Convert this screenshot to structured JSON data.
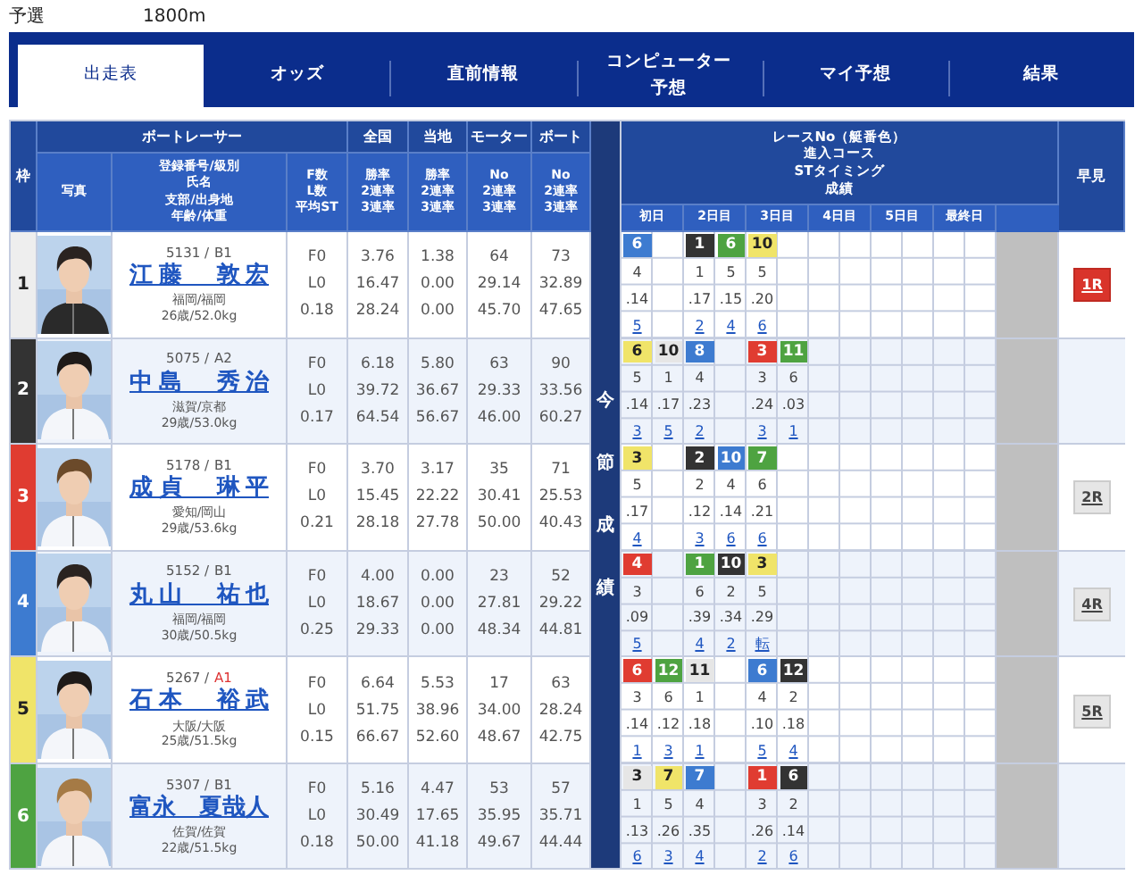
{
  "race": {
    "category": "予選",
    "distance": "1800m"
  },
  "tabs": [
    {
      "label": "出走表",
      "selected": true
    },
    {
      "label": "オッズ",
      "selected": false
    },
    {
      "label": "直前情報",
      "selected": false
    },
    {
      "label": "コンピューター予想",
      "selected": false
    },
    {
      "label": "マイ予想",
      "selected": false
    },
    {
      "label": "結果",
      "selected": false
    }
  ],
  "header": {
    "frame": "枠",
    "racer_group": "ボートレーサー",
    "photo": "写真",
    "profile_lines": [
      "登録番号/級別",
      "氏名",
      "支部/出身地",
      "年齢/体重"
    ],
    "fl_lines": [
      "F数",
      "L数",
      "平均ST"
    ],
    "stat_groups": [
      {
        "title": "全国",
        "lines": [
          "勝率",
          "2連率",
          "3連率"
        ]
      },
      {
        "title": "当地",
        "lines": [
          "勝率",
          "2連率",
          "3連率"
        ]
      },
      {
        "title": "モーター",
        "lines": [
          "No",
          "2連率",
          "3連率"
        ]
      },
      {
        "title": "ボート",
        "lines": [
          "No",
          "2連率",
          "3連率"
        ]
      }
    ],
    "series_title_lines": [
      "レースNo（艇番色）",
      "進入コース",
      "STタイミング",
      "成績"
    ],
    "days": [
      "初日",
      "2日目",
      "3日目",
      "4日目",
      "5日目",
      "最終日"
    ],
    "early_look": "早見",
    "series_side": "今節成績"
  },
  "racers": [
    {
      "frame": "1",
      "color": "#eeeeee",
      "reg": "5131 /",
      "class": "B1",
      "class_emphasis": false,
      "name": "江藤　敦宏",
      "branch": "福岡/福岡",
      "age_weight": "26歳/52.0kg",
      "fl": [
        "F0",
        "L0",
        "0.18"
      ],
      "stats": [
        [
          "3.76",
          "16.47",
          "28.24"
        ],
        [
          "1.38",
          "0.00",
          "0.00"
        ],
        [
          "64",
          "29.14",
          "45.70"
        ],
        [
          "73",
          "32.89",
          "47.65"
        ]
      ],
      "days": [
        {
          "races": [
            {
              "race_no": "6",
              "color": "#3d7bd0",
              "course": "4",
              "st": ".14",
              "result": "5"
            }
          ]
        },
        {
          "races": [
            {
              "race_no": "1",
              "color": "#333333",
              "course": "1",
              "st": ".17",
              "result": "2"
            },
            {
              "race_no": "6",
              "color": "#4ea341",
              "course": "5",
              "st": ".15",
              "result": "4"
            }
          ]
        },
        {
          "races": [
            {
              "race_no": "10",
              "color": "#f0e469",
              "course": "5",
              "st": ".20",
              "result": "6"
            }
          ]
        }
      ],
      "early_look": {
        "label": "1R",
        "highlighted": true
      }
    },
    {
      "frame": "2",
      "color": "#333333",
      "reg": "5075 /",
      "class": "A2",
      "class_emphasis": false,
      "name": "中島　秀治",
      "branch": "滋賀/京都",
      "age_weight": "29歳/53.0kg",
      "fl": [
        "F0",
        "L0",
        "0.17"
      ],
      "stats": [
        [
          "6.18",
          "39.72",
          "64.54"
        ],
        [
          "5.80",
          "36.67",
          "56.67"
        ],
        [
          "63",
          "29.33",
          "46.00"
        ],
        [
          "90",
          "33.56",
          "60.27"
        ]
      ],
      "days": [
        {
          "races": [
            {
              "race_no": "6",
              "color": "#f0e469",
              "course": "5",
              "st": ".14",
              "result": "3"
            },
            {
              "race_no": "10",
              "color": "#e6e6e6",
              "course": "1",
              "st": ".17",
              "result": "5"
            }
          ]
        },
        {
          "races": [
            {
              "race_no": "8",
              "color": "#3d7bd0",
              "course": "4",
              "st": ".23",
              "result": "2"
            }
          ]
        },
        {
          "races": [
            {
              "race_no": "3",
              "color": "#e03c31",
              "course": "3",
              "st": ".24",
              "result": "3"
            },
            {
              "race_no": "11",
              "color": "#4ea341",
              "course": "6",
              "st": ".03",
              "result": "1"
            }
          ]
        }
      ]
    },
    {
      "frame": "3",
      "color": "#e03c31",
      "reg": "5178 /",
      "class": "B1",
      "class_emphasis": false,
      "name": "成貞　琳平",
      "branch": "愛知/岡山",
      "age_weight": "29歳/53.6kg",
      "fl": [
        "F0",
        "L0",
        "0.21"
      ],
      "stats": [
        [
          "3.70",
          "15.45",
          "28.18"
        ],
        [
          "3.17",
          "22.22",
          "27.78"
        ],
        [
          "35",
          "30.41",
          "50.00"
        ],
        [
          "71",
          "25.53",
          "40.43"
        ]
      ],
      "days": [
        {
          "races": [
            {
              "race_no": "3",
              "color": "#f0e469",
              "course": "5",
              "st": ".17",
              "result": "4"
            }
          ]
        },
        {
          "races": [
            {
              "race_no": "2",
              "color": "#333333",
              "course": "2",
              "st": ".12",
              "result": "3"
            },
            {
              "race_no": "10",
              "color": "#3d7bd0",
              "course": "4",
              "st": ".14",
              "result": "6"
            }
          ]
        },
        {
          "races": [
            {
              "race_no": "7",
              "color": "#4ea341",
              "course": "6",
              "st": ".21",
              "result": "6"
            }
          ]
        }
      ],
      "early_look": {
        "label": "2R",
        "highlighted": false
      }
    },
    {
      "frame": "4",
      "color": "#3d7bd0",
      "reg": "5152 /",
      "class": "B1",
      "class_emphasis": false,
      "name": "丸山　祐也",
      "branch": "福岡/福岡",
      "age_weight": "30歳/50.5kg",
      "fl": [
        "F0",
        "L0",
        "0.25"
      ],
      "stats": [
        [
          "4.00",
          "18.67",
          "29.33"
        ],
        [
          "0.00",
          "0.00",
          "0.00"
        ],
        [
          "23",
          "27.81",
          "48.34"
        ],
        [
          "52",
          "29.22",
          "44.81"
        ]
      ],
      "days": [
        {
          "races": [
            {
              "race_no": "4",
              "color": "#e03c31",
              "course": "3",
              "st": ".09",
              "result": "5"
            }
          ]
        },
        {
          "races": [
            {
              "race_no": "1",
              "color": "#4ea341",
              "course": "6",
              "st": ".39",
              "result": "4"
            },
            {
              "race_no": "10",
              "color": "#333333",
              "course": "2",
              "st": ".34",
              "result": "2"
            }
          ]
        },
        {
          "races": [
            {
              "race_no": "3",
              "color": "#f0e469",
              "course": "5",
              "st": ".29",
              "result": "転"
            }
          ]
        }
      ],
      "early_look": {
        "label": "4R",
        "highlighted": false
      }
    },
    {
      "frame": "5",
      "color": "#f0e469",
      "reg": "5267 /",
      "class": "A1",
      "class_emphasis": true,
      "name": "石本　裕武",
      "branch": "大阪/大阪",
      "age_weight": "25歳/51.5kg",
      "fl": [
        "F0",
        "L0",
        "0.15"
      ],
      "stats": [
        [
          "6.64",
          "51.75",
          "66.67"
        ],
        [
          "5.53",
          "38.96",
          "52.60"
        ],
        [
          "17",
          "34.00",
          "48.67"
        ],
        [
          "63",
          "28.24",
          "42.75"
        ]
      ],
      "days": [
        {
          "races": [
            {
              "race_no": "6",
              "color": "#e03c31",
              "course": "3",
              "st": ".14",
              "result": "1"
            },
            {
              "race_no": "12",
              "color": "#4ea341",
              "course": "6",
              "st": ".12",
              "result": "3"
            }
          ]
        },
        {
          "races": [
            {
              "race_no": "11",
              "color": "#e6e6e6",
              "course": "1",
              "st": ".18",
              "result": "1"
            }
          ]
        },
        {
          "races": [
            {
              "race_no": "6",
              "color": "#3d7bd0",
              "course": "4",
              "st": ".10",
              "result": "5"
            },
            {
              "race_no": "12",
              "color": "#333333",
              "course": "2",
              "st": ".18",
              "result": "4"
            }
          ]
        }
      ],
      "early_look": {
        "label": "5R",
        "highlighted": false
      }
    },
    {
      "frame": "6",
      "color": "#4ea341",
      "reg": "5307 /",
      "class": "B1",
      "class_emphasis": false,
      "name": "富永　夏哉人",
      "branch": "佐賀/佐賀",
      "age_weight": "22歳/51.5kg",
      "fl": [
        "F0",
        "L0",
        "0.18"
      ],
      "stats": [
        [
          "5.16",
          "30.49",
          "50.00"
        ],
        [
          "4.47",
          "17.65",
          "41.18"
        ],
        [
          "53",
          "35.95",
          "49.67"
        ],
        [
          "57",
          "35.71",
          "44.44"
        ]
      ],
      "days": [
        {
          "races": [
            {
              "race_no": "3",
              "color": "#e6e6e6",
              "course": "1",
              "st": ".13",
              "result": "6"
            },
            {
              "race_no": "7",
              "color": "#f0e469",
              "course": "5",
              "st": ".26",
              "result": "3"
            }
          ]
        },
        {
          "races": [
            {
              "race_no": "7",
              "color": "#3d7bd0",
              "course": "4",
              "st": ".35",
              "result": "4"
            }
          ]
        },
        {
          "races": [
            {
              "race_no": "1",
              "color": "#e03c31",
              "course": "3",
              "st": ".26",
              "result": "2"
            },
            {
              "race_no": "6",
              "color": "#333333",
              "course": "2",
              "st": ".14",
              "result": "6"
            }
          ]
        }
      ]
    }
  ]
}
